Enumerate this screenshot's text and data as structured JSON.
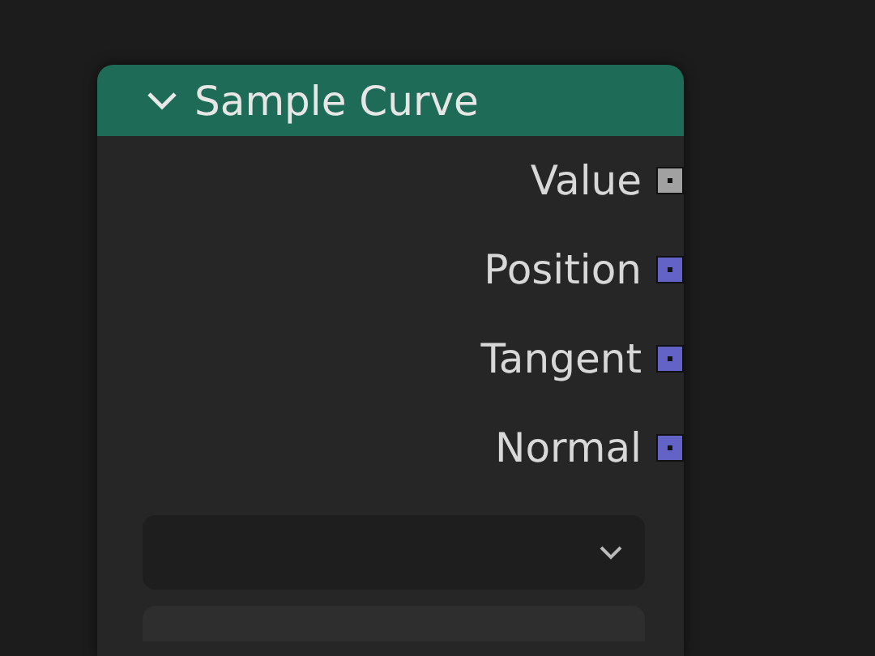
{
  "node": {
    "title": "Sample Curve",
    "expanded": true,
    "outputs": [
      {
        "label": "Value",
        "color": "#a1a1a1"
      },
      {
        "label": "Position",
        "color": "#6363c7"
      },
      {
        "label": "Tangent",
        "color": "#6363c7"
      },
      {
        "label": "Normal",
        "color": "#6363c7"
      }
    ]
  }
}
